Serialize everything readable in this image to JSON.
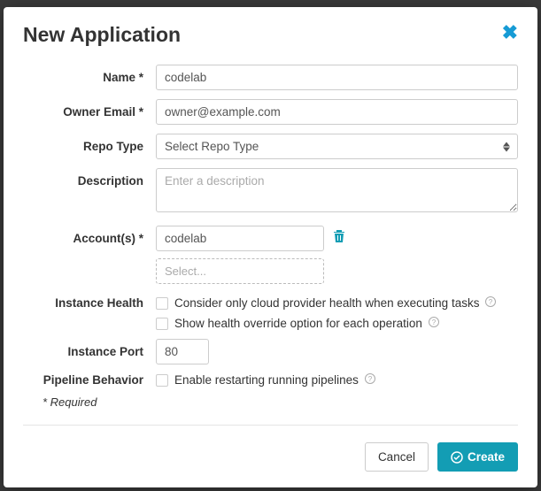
{
  "modal": {
    "title": "New Application",
    "labels": {
      "name": "Name *",
      "ownerEmail": "Owner Email *",
      "repoType": "Repo Type",
      "description": "Description",
      "accounts": "Account(s) *",
      "instanceHealth": "Instance Health",
      "instancePort": "Instance Port",
      "pipelineBehavior": "Pipeline Behavior"
    },
    "fields": {
      "name": "codelab",
      "ownerEmail": "owner@example.com",
      "repoType": "Select Repo Type",
      "descriptionPlaceholder": "Enter a description",
      "account0": "codelab",
      "accountSelectPlaceholder": "Select...",
      "instancePort": "80"
    },
    "checkboxes": {
      "healthConsider": "Consider only cloud provider health when executing tasks",
      "healthOverride": "Show health override option for each operation",
      "pipelineRestart": "Enable restarting running pipelines"
    },
    "requiredNote": "* Required",
    "buttons": {
      "cancel": "Cancel",
      "create": "Create"
    }
  }
}
